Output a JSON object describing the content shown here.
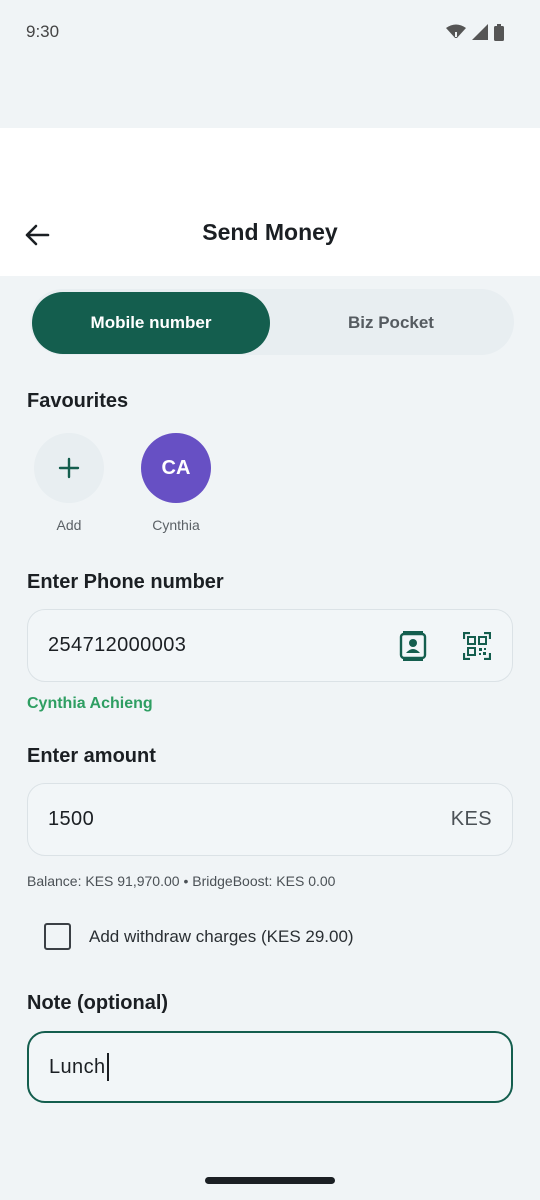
{
  "status_bar": {
    "time": "9:30"
  },
  "header": {
    "title": "Send Money",
    "back_icon": "arrow-left-icon"
  },
  "tabs": [
    {
      "label": "Mobile number",
      "active": true
    },
    {
      "label": "Biz Pocket",
      "active": false
    }
  ],
  "favourites": {
    "heading": "Favourites",
    "add_label": "Add",
    "contacts": [
      {
        "initials": "CA",
        "name": "Cynthia",
        "color": "#6750c4"
      }
    ]
  },
  "phone": {
    "label": "Enter Phone number",
    "value": "254712000003",
    "resolved_name": "Cynthia Achieng",
    "contacts_icon": "contact-book-icon",
    "qr_icon": "qr-scan-icon"
  },
  "amount": {
    "label": "Enter amount",
    "value": "1500",
    "currency": "KES",
    "balance_info": "Balance: KES 91,970.00 • BridgeBoost: KES 0.00"
  },
  "withdraw_charges": {
    "label": "Add withdraw charges (KES 29.00)",
    "checked": false
  },
  "note": {
    "label": "Note (optional)",
    "value": "Lunch"
  },
  "colors": {
    "primary": "#145e4e",
    "success_text": "#2e9e62",
    "avatar": "#6750c4"
  }
}
